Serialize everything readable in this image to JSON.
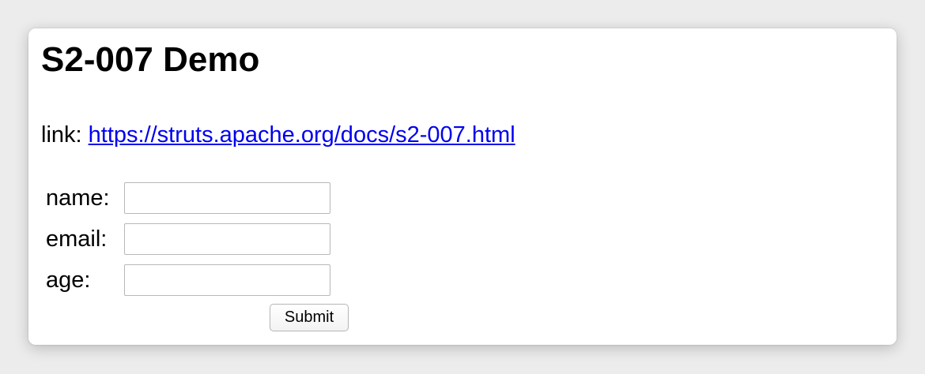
{
  "page": {
    "title": "S2-007 Demo",
    "link_prefix": "link: ",
    "link_text": "https://struts.apache.org/docs/s2-007.html"
  },
  "form": {
    "fields": [
      {
        "label": "name:",
        "value": ""
      },
      {
        "label": "email:",
        "value": ""
      },
      {
        "label": "age:",
        "value": ""
      }
    ],
    "submit_label": "Submit"
  },
  "colors": {
    "link": "#0000ee",
    "background": "#ececec",
    "panel": "#ffffff"
  }
}
